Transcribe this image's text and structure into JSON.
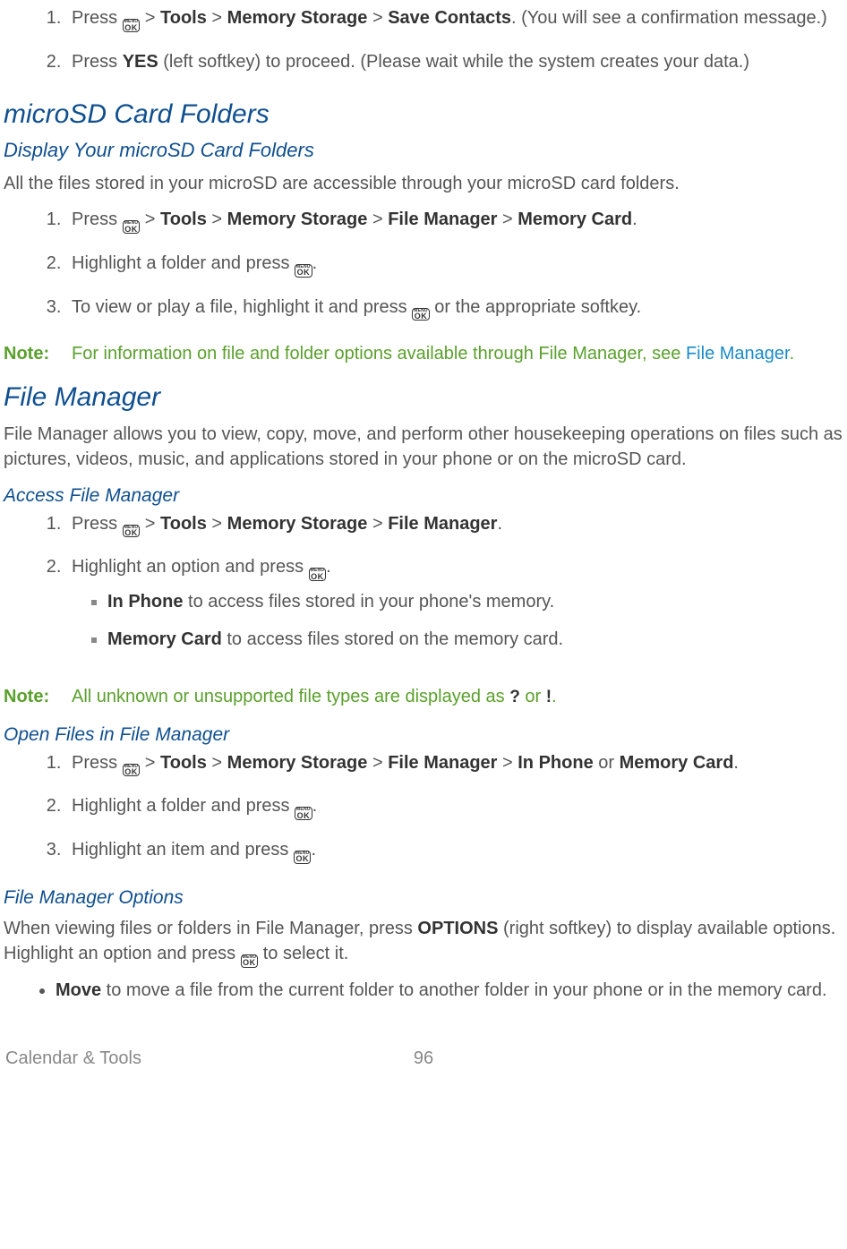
{
  "top_steps": {
    "item1_prefix": "Press ",
    "item1_sep": " > ",
    "item1_b1": "Tools",
    "item1_b2": "Memory Storage",
    "item1_b3": "Save Contacts",
    "item1_suffix": ". (You will see a confirmation message.)",
    "item2_prefix": "Press ",
    "item2_bold": "YES",
    "item2_suffix": " (left softkey) to proceed. (Please wait while the system creates your data.)"
  },
  "sd": {
    "h2": "microSD Card Folders",
    "h3": "Display Your microSD Card Folders",
    "intro": "All the files stored in your microSD are accessible through your microSD card folders.",
    "s1_prefix": "Press ",
    "s1_sep": " > ",
    "s1_b1": "Tools",
    "s1_b2": "Memory Storage",
    "s1_b3": "File Manager",
    "s1_b4": "Memory Card",
    "s1_end": ".",
    "s2_prefix": "Highlight a folder and press ",
    "s2_end": ".",
    "s3_prefix": "To view or play a file, highlight it and press ",
    "s3_suffix": " or the appropriate softkey."
  },
  "note1": {
    "label": "Note:",
    "text_a": "For information on file and folder options available through File Manager, see ",
    "link": "File Manager",
    "text_b": "."
  },
  "fm": {
    "h2": "File Manager",
    "intro": "File Manager allows you to view, copy, move, and perform other housekeeping operations on files such as pictures, videos, music, and applications stored in your phone or on the microSD card."
  },
  "access": {
    "h4": "Access File Manager",
    "s1_prefix": "Press ",
    "s1_sep": " > ",
    "s1_b1": "Tools",
    "s1_b2": "Memory Storage",
    "s1_b3": "File Manager",
    "s1_end": ".",
    "s2_prefix": "Highlight an option and press ",
    "s2_end": ".",
    "sub1_b": "In Phone",
    "sub1_t": " to access files stored in your phone's memory.",
    "sub2_b": "Memory Card",
    "sub2_t": " to access files stored on the memory card."
  },
  "note2": {
    "label": "Note:",
    "text_a": "All unknown or unsupported file types are displayed as ",
    "text_mid": "or ",
    "text_end": "."
  },
  "open": {
    "h4": "Open Files in File Manager",
    "s1_prefix": "Press ",
    "s1_sep": " > ",
    "s1_b1": "Tools",
    "s1_b2": "Memory Storage",
    "s1_b3": "File Manager",
    "s1_b4a": "In Phone",
    "s1_or": " or ",
    "s1_b4b": "Memory Card",
    "s1_end": ".",
    "s2_prefix": "Highlight a folder and press ",
    "s2_end": ".",
    "s3_prefix": "Highlight an item and press ",
    "s3_end": "."
  },
  "options": {
    "h4": "File Manager Options",
    "intro_a": "When viewing files or folders in File Manager, press ",
    "intro_b": "OPTIONS",
    "intro_c": " (right softkey) to display available options. Highlight an option and press ",
    "intro_d": " to select it.",
    "bullet_b": "Move",
    "bullet_t": " to move a file from the current folder to another folder in your phone or in the memory card."
  },
  "footer": {
    "left": "Calendar & Tools",
    "page": "96"
  },
  "key": {
    "menu": "MENU",
    "ok": "OK"
  },
  "icons": {
    "q": "?",
    "ex": "!"
  }
}
